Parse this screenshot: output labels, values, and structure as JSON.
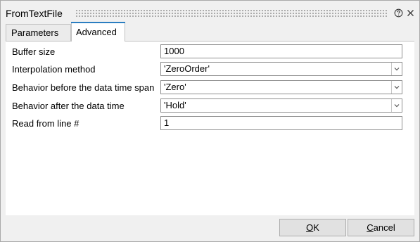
{
  "window": {
    "title": "FromTextFile"
  },
  "tabs": [
    {
      "label": "Parameters",
      "active": false
    },
    {
      "label": "Advanced",
      "active": true
    }
  ],
  "fields": [
    {
      "label": "Buffer size",
      "value": "1000",
      "kind": "text"
    },
    {
      "label": "Interpolation method",
      "value": "'ZeroOrder'",
      "kind": "dropdown"
    },
    {
      "label": "Behavior before the data time span",
      "value": "'Zero'",
      "kind": "dropdown"
    },
    {
      "label": "Behavior after the data time",
      "value": "'Hold'",
      "kind": "dropdown"
    },
    {
      "label": "Read from line #",
      "value": "1",
      "kind": "text"
    }
  ],
  "buttons": {
    "ok": {
      "mnemonic": "O",
      "rest": "K"
    },
    "cancel": {
      "mnemonic": "C",
      "rest": "ancel"
    }
  },
  "icons": {
    "help": "help-icon",
    "close": "close-icon",
    "dropdown": "chevron-down-icon",
    "grip": "drag-grip"
  },
  "colors": {
    "window_bg": "#f0f0f0",
    "panel_bg": "#ffffff",
    "tab_accent": "#2b7ec1",
    "button_bg": "#e1e1e1",
    "border": "#8f8f8f"
  }
}
